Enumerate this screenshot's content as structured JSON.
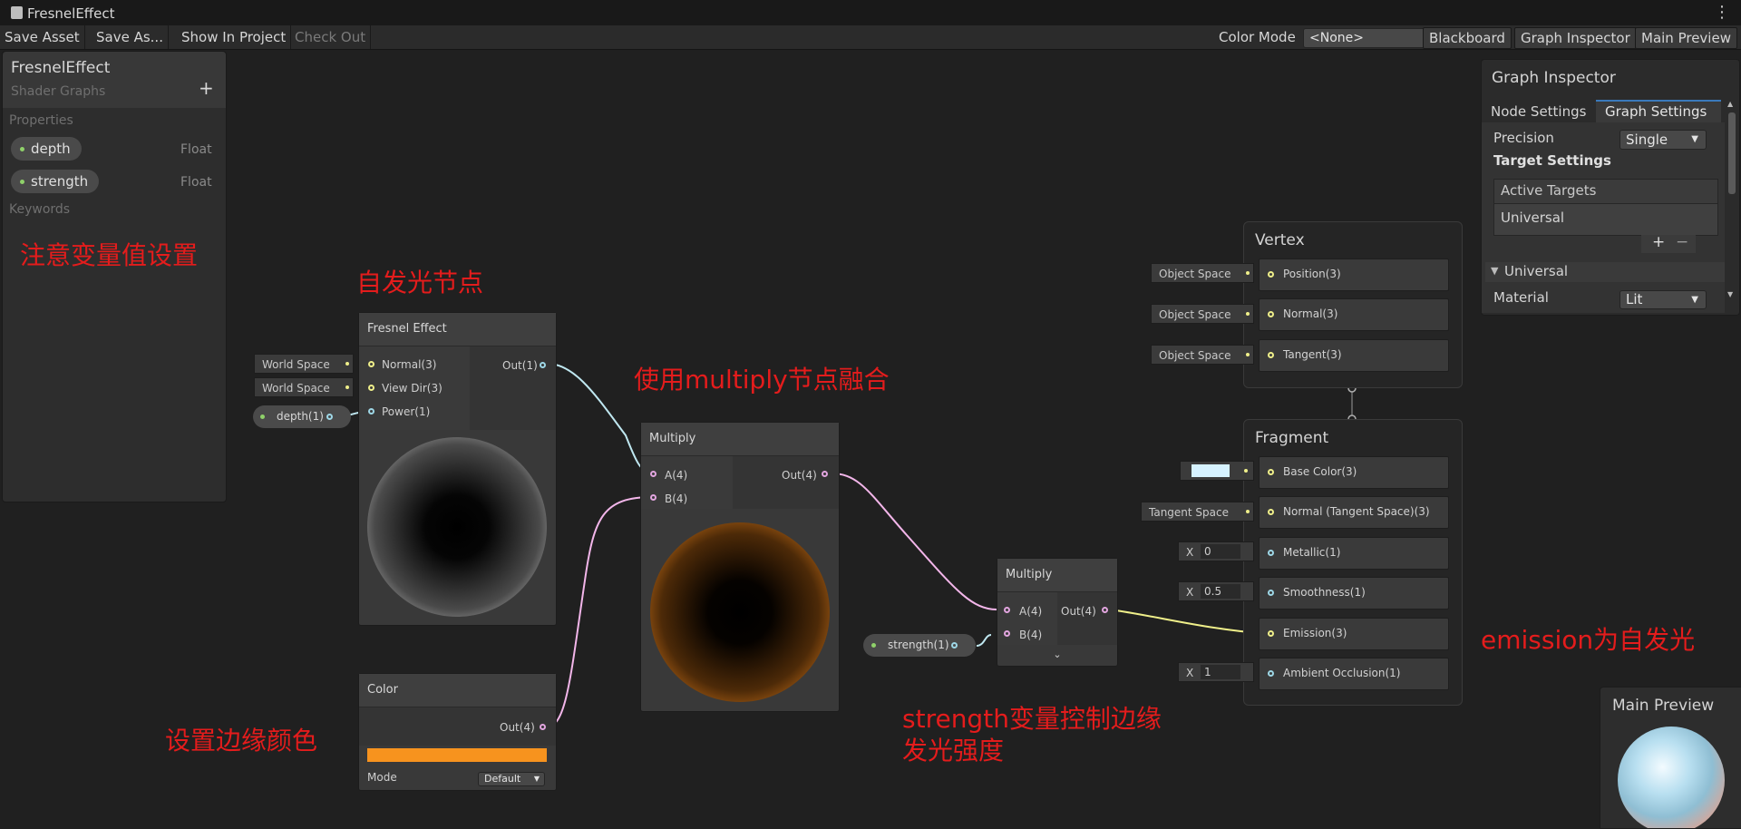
{
  "window": {
    "title": "FresnelEffect"
  },
  "toolbar": {
    "save_asset": "Save Asset",
    "save_as": "Save As...",
    "show_in_project": "Show In Project",
    "check_out": "Check Out",
    "color_mode_label": "Color Mode",
    "color_mode_value": "<None>",
    "blackboard": "Blackboard",
    "graph_inspector": "Graph Inspector",
    "main_preview": "Main Preview"
  },
  "blackboard": {
    "title": "FresnelEffect",
    "subtitle": "Shader Graphs",
    "add": "+",
    "properties_label": "Properties",
    "properties": [
      {
        "name": "depth",
        "type": "Float"
      },
      {
        "name": "strength",
        "type": "Float"
      }
    ],
    "keywords_label": "Keywords"
  },
  "annotations": {
    "var_settings": "注意变量值设置",
    "emissive_node": "自发光节点",
    "multiply_blend": "使用multiply节点融合",
    "edge_color": "设置边缘颜色",
    "strength_line1": "strength变量控制边缘",
    "strength_line2": "发光强度",
    "emission": "emission为自发光"
  },
  "fresnel_node": {
    "title": "Fresnel Effect",
    "inputs": [
      "Normal(3)",
      "View Dir(3)",
      "Power(1)"
    ],
    "input_values": [
      "World Space",
      "World Space"
    ],
    "output": "Out(1)",
    "property_input": "depth(1)"
  },
  "color_node": {
    "title": "Color",
    "output": "Out(4)",
    "mode_label": "Mode",
    "mode_value": "Default",
    "color": "#f7931e"
  },
  "multiply1": {
    "title": "Multiply",
    "inputs": [
      "A(4)",
      "B(4)"
    ],
    "output": "Out(4)"
  },
  "multiply2": {
    "title": "Multiply",
    "inputs": [
      "A(4)",
      "B(4)"
    ],
    "output": "Out(4)",
    "property_input": "strength(1)"
  },
  "vertex": {
    "title": "Vertex",
    "slots": [
      "Position(3)",
      "Normal(3)",
      "Tangent(3)"
    ],
    "spaces": [
      "Object Space",
      "Object Space",
      "Object Space"
    ]
  },
  "fragment": {
    "title": "Fragment",
    "slots": [
      "Base Color(3)",
      "Normal (Tangent Space)(3)",
      "Metallic(1)",
      "Smoothness(1)",
      "Emission(3)",
      "Ambient Occlusion(1)"
    ],
    "normal_space": "Tangent Space",
    "x_label": "X",
    "metallic": "0",
    "smoothness": "0.5",
    "ambient_occlusion": "1",
    "base_color": "#d6f2ff"
  },
  "inspector": {
    "title": "Graph Inspector",
    "tabs": [
      "Node Settings",
      "Graph Settings"
    ],
    "precision_label": "Precision",
    "precision_value": "Single",
    "target_settings": "Target Settings",
    "active_targets": "Active Targets",
    "target": "Universal",
    "add": "+",
    "remove": "−",
    "universal_section": "Universal",
    "material_label": "Material",
    "material_value": "Lit"
  },
  "main_preview": {
    "title": "Main Preview"
  },
  "colors": {
    "accent_pink": "#f3b6ea",
    "accent_cyan": "#9ed7e6",
    "accent_yellow": "#efef8a",
    "annotation_red": "#e41c1c"
  }
}
